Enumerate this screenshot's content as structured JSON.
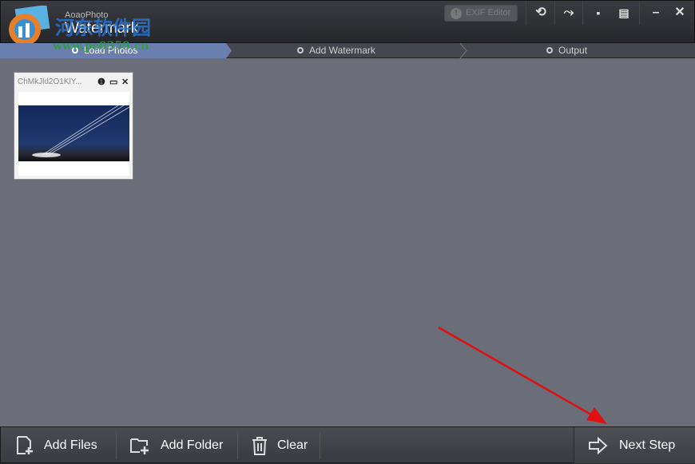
{
  "app": {
    "subtitle": "AoaoPhoto",
    "title": "Watermark"
  },
  "watermark": {
    "site_name": "河东软件园",
    "url": "www.pc0359.cn"
  },
  "toolbar": {
    "exif_label": "EXIF Editor",
    "icons": [
      "undo-icon",
      "hammer-icon",
      "chat-icon",
      "register-icon",
      "minimize-icon",
      "close-icon"
    ]
  },
  "steps": [
    {
      "label": "Load Photos",
      "active": true
    },
    {
      "label": "Add Watermark",
      "active": false
    },
    {
      "label": "Output",
      "active": false
    }
  ],
  "photos": [
    {
      "name": "ChMkJld2O1KlY..."
    }
  ],
  "bottom": {
    "add_files": "Add Files",
    "add_folder": "Add Folder",
    "clear": "Clear",
    "next_step": "Next Step"
  },
  "colors": {
    "active_step": "#6b7faf",
    "workspace": "#6b6e79",
    "annotation_arrow": "#e01010"
  }
}
